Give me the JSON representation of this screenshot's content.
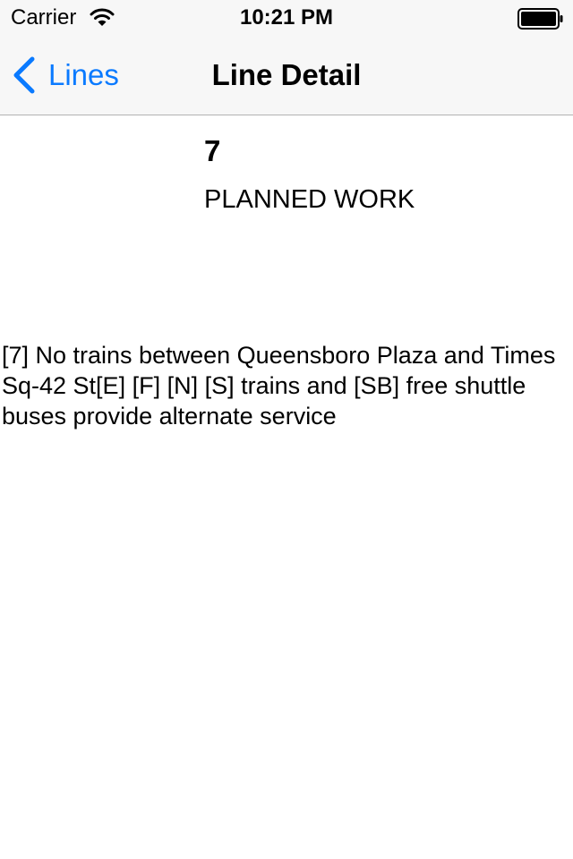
{
  "status_bar": {
    "carrier": "Carrier",
    "time": "10:21 PM"
  },
  "nav": {
    "back_label": "Lines",
    "title": "Line Detail"
  },
  "detail": {
    "line": "7",
    "status": "PLANNED WORK",
    "message": "[7] No trains between Queensboro Plaza and Times Sq-42 St[E] [F] [N] [S] trains and [SB] free shuttle buses provide alternate service"
  },
  "colors": {
    "accent": "#0a7aff",
    "bar_background": "#f7f7f7",
    "bar_border": "#b2b2b2"
  },
  "icons": {
    "wifi": "wifi-icon",
    "battery": "battery-icon",
    "back": "chevron-left-icon"
  }
}
